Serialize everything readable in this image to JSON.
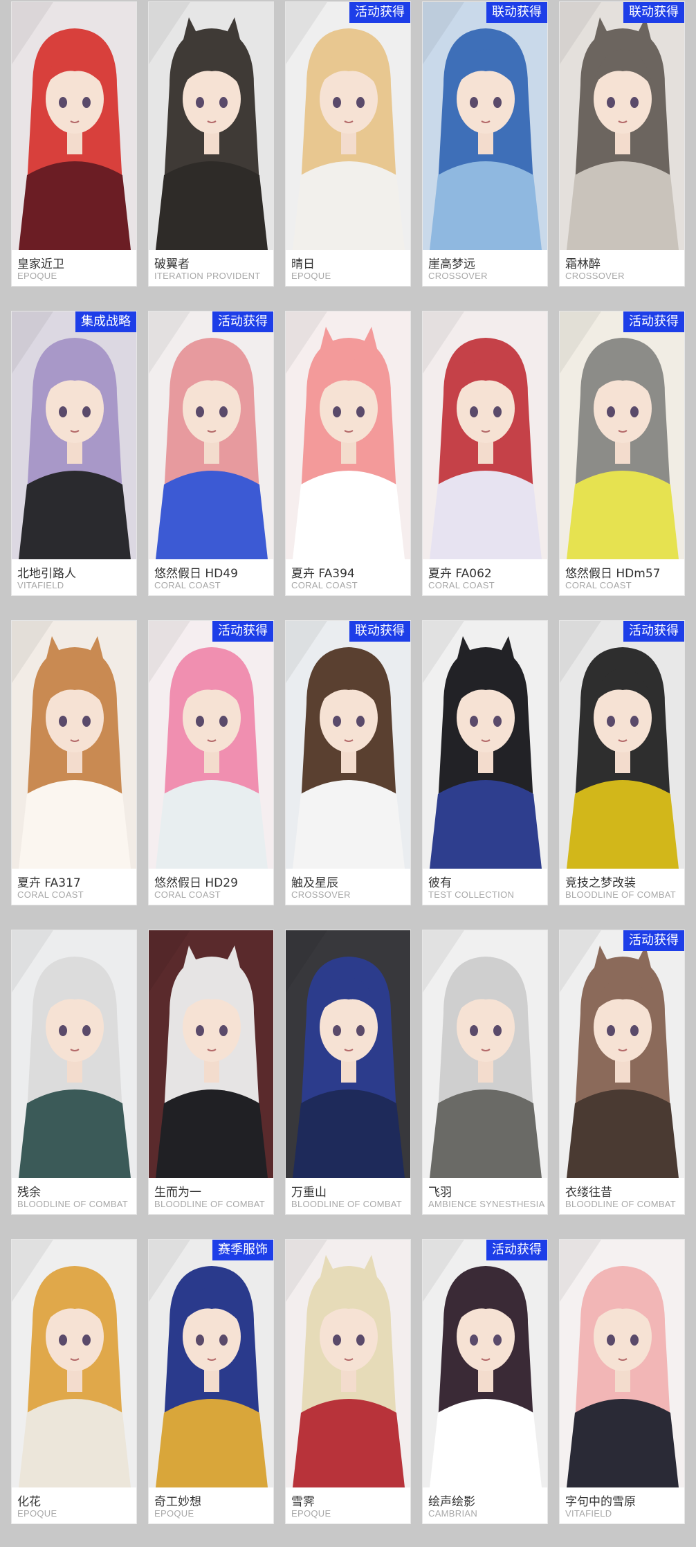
{
  "grid": {
    "cards": [
      {
        "name": "皇家近卫",
        "series": "EPOQUE",
        "badge": "",
        "hair": "#d8403c",
        "bg": "#e9e4e6",
        "outfit": "#6b1d24"
      },
      {
        "name": "破翼者",
        "series": "ITERATION PROVIDENT",
        "badge": "",
        "hair": "#3f3a36",
        "bg": "#e6e6e6",
        "outfit": "#2e2b28"
      },
      {
        "name": "晴日",
        "series": "EPOQUE",
        "badge": "活动获得",
        "hair": "#e8c790",
        "bg": "#efefef",
        "outfit": "#f2f0ec"
      },
      {
        "name": "崖高梦远",
        "series": "CROSSOVER",
        "badge": "联动获得",
        "hair": "#3e6fb8",
        "bg": "#c9d9ea",
        "outfit": "#8fb8e0"
      },
      {
        "name": "霜林醉",
        "series": "CROSSOVER",
        "badge": "联动获得",
        "hair": "#6c655f",
        "bg": "#e4e0dc",
        "outfit": "#c9c3bb"
      },
      {
        "name": "北地引路人",
        "series": "VITAFIELD",
        "badge": "集成战略",
        "hair": "#a898c8",
        "bg": "#dcd8e2",
        "outfit": "#2a2a2e"
      },
      {
        "name": "悠然假日 HD49",
        "series": "CORAL COAST",
        "badge": "活动获得",
        "hair": "#e79a9e",
        "bg": "#f2eeee",
        "outfit": "#3c5ad4"
      },
      {
        "name": "夏卉 FA394",
        "series": "CORAL COAST",
        "badge": "",
        "hair": "#f39a9a",
        "bg": "#f6eeee",
        "outfit": "#ffffff"
      },
      {
        "name": "夏卉 FA062",
        "series": "CORAL COAST",
        "badge": "",
        "hair": "#c54148",
        "bg": "#f3eded",
        "outfit": "#e7e3f1"
      },
      {
        "name": "悠然假日 HDm57",
        "series": "CORAL COAST",
        "badge": "活动获得",
        "hair": "#8c8c88",
        "bg": "#f1ede4",
        "outfit": "#e6e250"
      },
      {
        "name": "夏卉 FA317",
        "series": "CORAL COAST",
        "badge": "",
        "hair": "#c98a52",
        "bg": "#f2ece6",
        "outfit": "#fbf6f0"
      },
      {
        "name": "悠然假日 HD29",
        "series": "CORAL COAST",
        "badge": "活动获得",
        "hair": "#f08fb0",
        "bg": "#f5eef0",
        "outfit": "#e8eef0"
      },
      {
        "name": "触及星辰",
        "series": "CROSSOVER",
        "badge": "联动获得",
        "hair": "#5a4030",
        "bg": "#eaedf0",
        "outfit": "#f4f4f4"
      },
      {
        "name": "彼有",
        "series": "TEST COLLECTION",
        "badge": "",
        "hair": "#222226",
        "bg": "#f0f0f0",
        "outfit": "#2e3e8e"
      },
      {
        "name": "竞技之梦改装",
        "series": "BLOODLINE OF COMBAT",
        "badge": "活动获得",
        "hair": "#2e2e2e",
        "bg": "#e8e8e8",
        "outfit": "#d2b71a"
      },
      {
        "name": "残余",
        "series": "BLOODLINE OF COMBAT",
        "badge": "",
        "hair": "#dcdcdc",
        "bg": "#ecedee",
        "outfit": "#3b5a58"
      },
      {
        "name": "生而为一",
        "series": "BLOODLINE OF COMBAT",
        "badge": "",
        "hair": "#e6e4e4",
        "bg": "#5a2a2c",
        "outfit": "#202024"
      },
      {
        "name": "万重山",
        "series": "BLOODLINE OF COMBAT",
        "badge": "",
        "hair": "#2c3c8c",
        "bg": "#38383c",
        "outfit": "#1e2a5a"
      },
      {
        "name": "飞羽",
        "series": "AMBIENCE SYNESTHESIA",
        "badge": "",
        "hair": "#cfcfcf",
        "bg": "#f0f0f0",
        "outfit": "#6a6a66"
      },
      {
        "name": "衣缕往昔",
        "series": "BLOODLINE OF COMBAT",
        "badge": "活动获得",
        "hair": "#8b6a5a",
        "bg": "#efefef",
        "outfit": "#4a3a32"
      },
      {
        "name": "化花",
        "series": "EPOQUE",
        "badge": "",
        "hair": "#e0a84a",
        "bg": "#efefef",
        "outfit": "#ece6da"
      },
      {
        "name": "奇工妙想",
        "series": "EPOQUE",
        "badge": "赛季服饰",
        "hair": "#2a3a8c",
        "bg": "#ececec",
        "outfit": "#d9a63a"
      },
      {
        "name": "雪霁",
        "series": "EPOQUE",
        "badge": "",
        "hair": "#e6dbb8",
        "bg": "#f3eeee",
        "outfit": "#b8333a"
      },
      {
        "name": "绘声绘影",
        "series": "CAMBRIAN",
        "badge": "活动获得",
        "hair": "#3a2a36",
        "bg": "#efefef",
        "outfit": "#ffffff"
      },
      {
        "name": "字句中的雪原",
        "series": "VITAFIELD",
        "badge": "",
        "hair": "#f2b6b6",
        "bg": "#f5f1f1",
        "outfit": "#2a2a36"
      }
    ]
  }
}
